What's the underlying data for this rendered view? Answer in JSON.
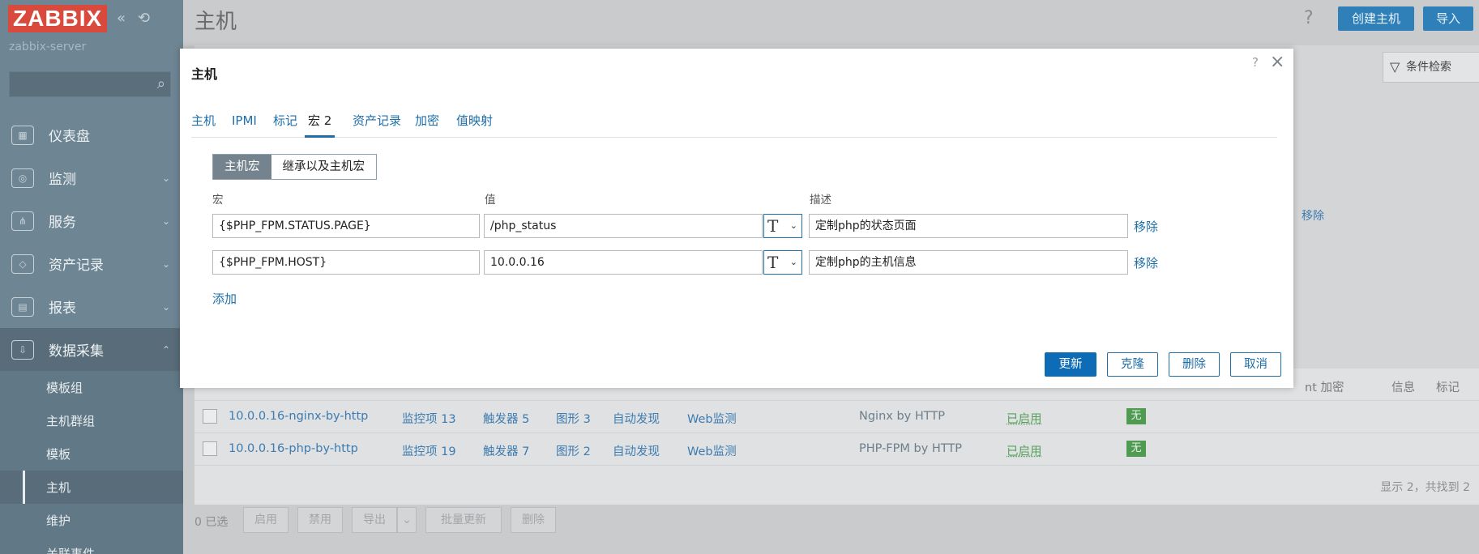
{
  "app": {
    "logo": "ZABBIX",
    "server": "zabbix-server",
    "collapse_icon": "«",
    "kiosk_icon": "⟲"
  },
  "sidebar": {
    "items": [
      {
        "label": "仪表盘",
        "icon": "dashboard-icon"
      },
      {
        "label": "监测",
        "icon": "monitoring-icon"
      },
      {
        "label": "服务",
        "icon": "services-icon"
      },
      {
        "label": "资产记录",
        "icon": "inventory-icon"
      },
      {
        "label": "报表",
        "icon": "reports-icon"
      },
      {
        "label": "数据采集",
        "icon": "data-collection-icon"
      }
    ],
    "subitems": [
      "模板组",
      "主机群组",
      "模板",
      "主机",
      "维护",
      "关联事件"
    ]
  },
  "page": {
    "title": "主机",
    "help": "?",
    "create_button": "创建主机",
    "import_button": "导入",
    "filter_tab": "条件检索"
  },
  "table": {
    "header_tail": {
      "encrypt": "nt 加密",
      "info": "信息",
      "tags": "标记"
    },
    "behind_remove": "移除",
    "rows": [
      {
        "name": "10.0.0.16-nginx-by-http",
        "items": "监控项 13",
        "triggers": "触发器 5",
        "graphs": "图形 3",
        "discovery": "自动发现",
        "web": "Web监测",
        "template": "Nginx by HTTP",
        "status": "已启用",
        "badge": "无"
      },
      {
        "name": "10.0.0.16-php-by-http",
        "items": "监控项 19",
        "triggers": "触发器 7",
        "graphs": "图形 2",
        "discovery": "自动发现",
        "web": "Web监测",
        "template": "PHP-FPM by HTTP",
        "status": "已启用",
        "badge": "无"
      }
    ],
    "found": "显示 2，共找到 2"
  },
  "bottom": {
    "selected": "0 已选",
    "enable": "启用",
    "disable": "禁用",
    "export": "导出",
    "mass_update": "批量更新",
    "delete": "删除"
  },
  "modal": {
    "title": "主机",
    "help": "?",
    "close": "×",
    "tabs": [
      "主机",
      "IPMI",
      "标记",
      "宏 2",
      "资产记录",
      "加密",
      "值映射"
    ],
    "active_tab": "宏 2",
    "segment": {
      "host_macros": "主机宏",
      "inherited": "继承以及主机宏"
    },
    "col_macro": "宏",
    "col_value": "值",
    "col_desc": "描述",
    "macros": [
      {
        "macro": "{$PHP_FPM.STATUS.PAGE}",
        "value": "/php_status",
        "type": "T",
        "desc": "定制php的状态页面",
        "remove": "移除"
      },
      {
        "macro": "{$PHP_FPM.HOST}",
        "value": "10.0.0.16",
        "type": "T",
        "desc": "定制php的主机信息",
        "remove": "移除"
      }
    ],
    "add": "添加",
    "buttons": {
      "update": "更新",
      "clone": "克隆",
      "delete": "删除",
      "cancel": "取消"
    }
  },
  "colors": {
    "accent": "#1e6ea8",
    "logo": "#d94a3c",
    "sidebar": "#6e8593",
    "enabled": "#57a05b"
  }
}
